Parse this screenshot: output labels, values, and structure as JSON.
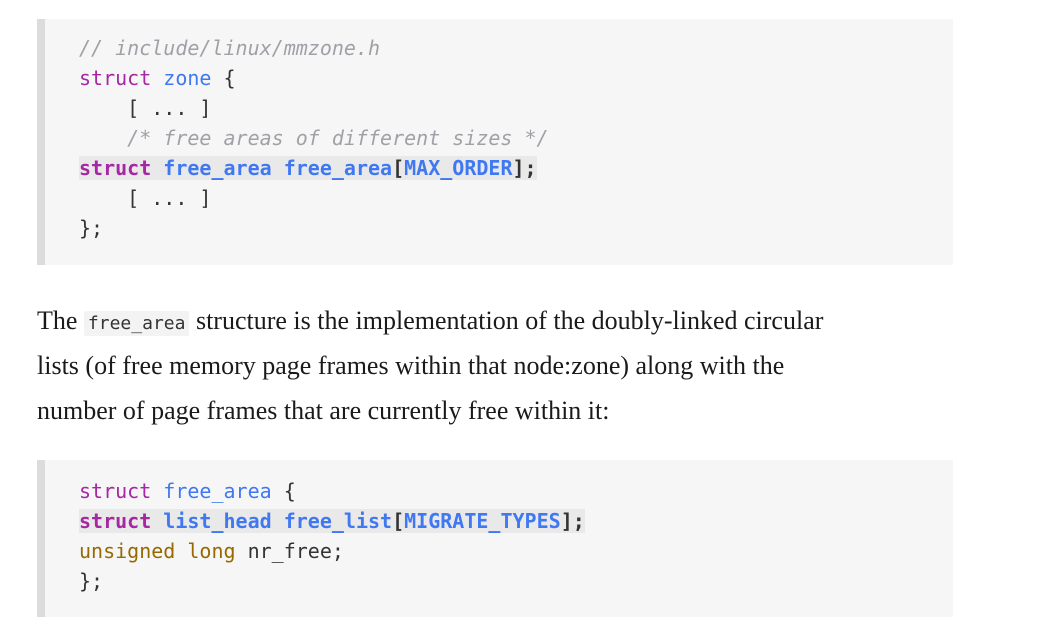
{
  "code_block_1": {
    "line1_comment": "// include/linux/mmzone.h",
    "line2_kw": "struct",
    "line2_name": "zone",
    "line2_brace": " {",
    "line3": "    [ ... ]",
    "line4_comment": "    /* free areas of different sizes */",
    "line5_kw": "struct",
    "line5_type": "free_area",
    "line5_field": "free_area",
    "line5_open": "[",
    "line5_const": "MAX_ORDER",
    "line5_close": "];",
    "line6": "    [ ... ]",
    "line7": "};"
  },
  "paragraph": {
    "line1_before": "The ",
    "inline_code": "free_area",
    "line1_after": " structure is the implementation of the doubly-linked circular",
    "line2": "lists (of free memory page frames within that node:zone) along with the",
    "line3": "number of page frames that are currently free within it:"
  },
  "code_block_2": {
    "line1_kw": "struct",
    "line1_name": "free_area",
    "line1_brace": " {",
    "line2_kw": "struct",
    "line2_type": "list_head",
    "line2_field": "free_list",
    "line2_open": "[",
    "line2_const": "MIGRATE_TYPES",
    "line2_close": "];",
    "line3_type": "unsigned long",
    "line3_field": " nr_free;",
    "line4": "};"
  }
}
